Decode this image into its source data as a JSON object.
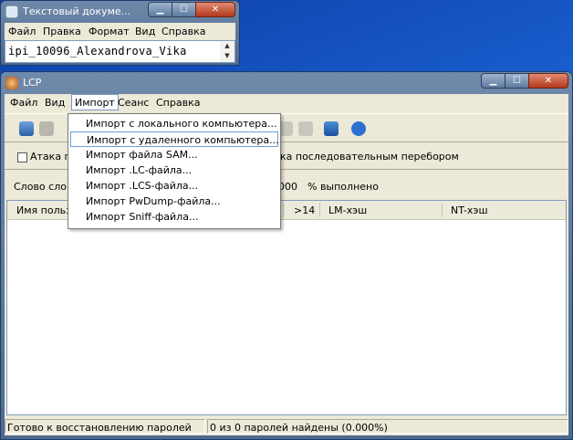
{
  "notepad": {
    "title": "Текстовый докуме...",
    "menu": [
      "Файл",
      "Правка",
      "Формат",
      "Вид",
      "Справка"
    ],
    "content": "ipi_10096_Alexandrova_Vika"
  },
  "lcp": {
    "title": "LCP",
    "menu": [
      "Файл",
      "Вид",
      "Импорт",
      "Сеанс",
      "Справка"
    ],
    "active_menu": "Импорт",
    "attack_label_left": "Атака по",
    "attack_label_right": "ка последовательным перебором",
    "dict_label": "Слово слов",
    "percent_value": "000",
    "percent_label": "% выполнено",
    "columns": [
      "Имя пользо",
      ">14",
      "LM-хэш",
      "NT-хэш"
    ],
    "status_left": "Готово к восстановлению паролей",
    "status_right": "0 из 0 паролей найдены (0.000%)"
  },
  "import_menu": {
    "items": [
      "Импорт с локального компьютера...",
      "Импорт с удаленного компьютера...",
      "Импорт файла SAM...",
      "Импорт .LC-файла...",
      "Импорт .LCS-файла...",
      "Импорт PwDump-файла...",
      "Импорт Sniff-файла..."
    ],
    "highlighted_index": 1
  },
  "colors": {
    "desktop": "#1a5fd0",
    "window_frame": "#5d7898",
    "close_button": "#c4472a",
    "menu_highlight_border": "#6f9dd9"
  }
}
